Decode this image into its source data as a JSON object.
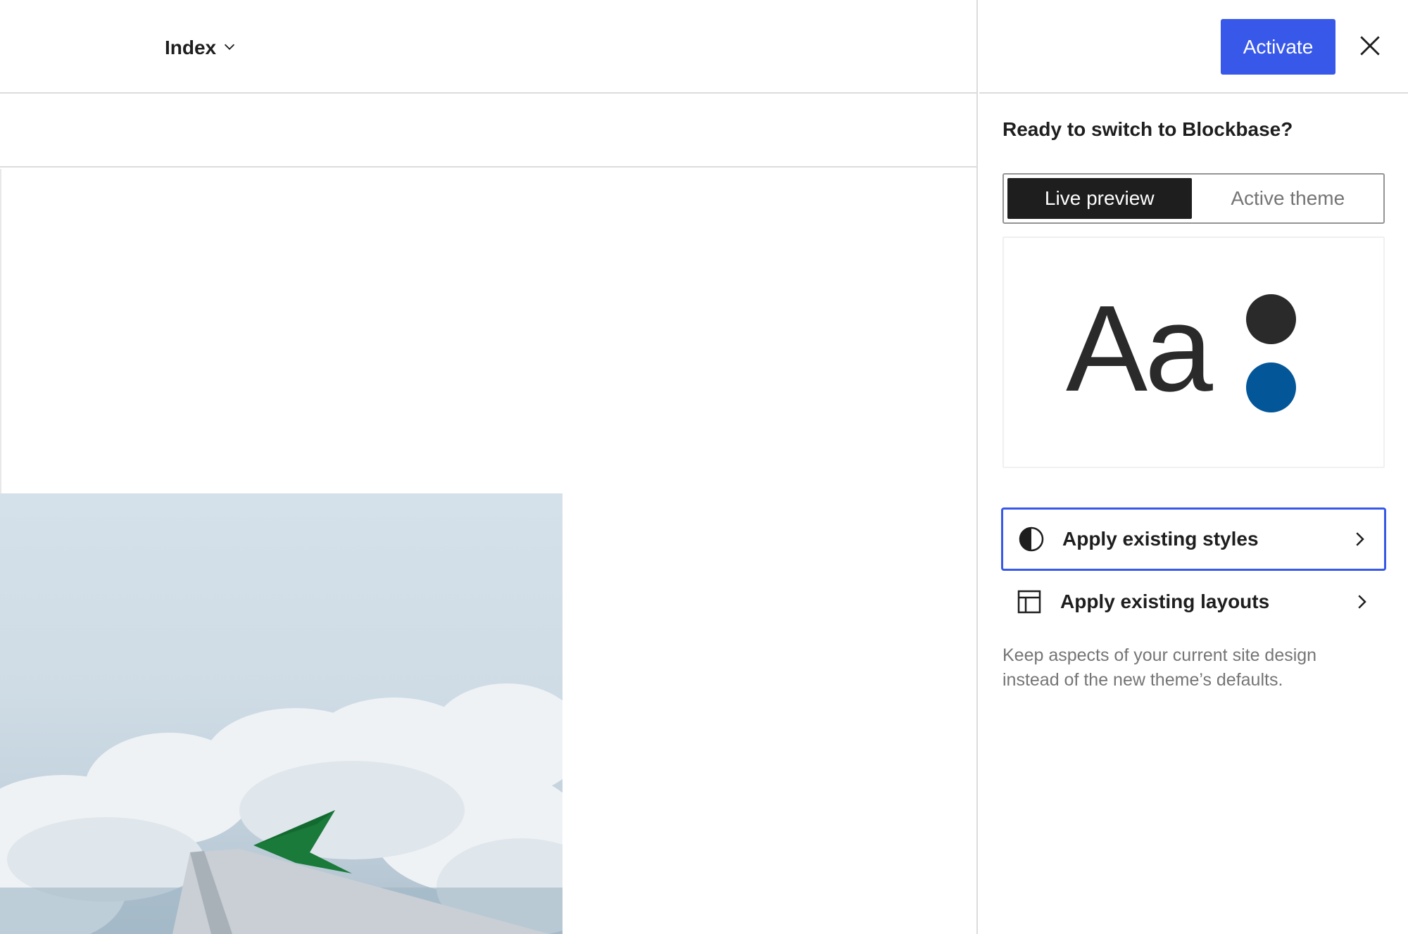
{
  "editor": {
    "template_label": "Index",
    "template_icon": "chevron-down-icon"
  },
  "sidebar": {
    "activate_label": "Activate",
    "close_icon": "close-icon",
    "title": "Ready to switch to Blockbase?",
    "toggle": {
      "options": [
        "Live preview",
        "Active theme"
      ],
      "selected": "Live preview"
    },
    "preview": {
      "sample_text": "Aa",
      "colors": [
        "#2a2a2a",
        "#035698"
      ]
    },
    "options": [
      {
        "label": "Apply existing styles",
        "icon": "contrast-half-circle-icon"
      },
      {
        "label": "Apply existing layouts",
        "icon": "layout-icon"
      }
    ],
    "help_text": "Keep aspects of your current site design instead of the new theme’s defaults."
  },
  "colors": {
    "accent": "#3858e9",
    "toggle_active_bg": "#1e1e1e"
  }
}
